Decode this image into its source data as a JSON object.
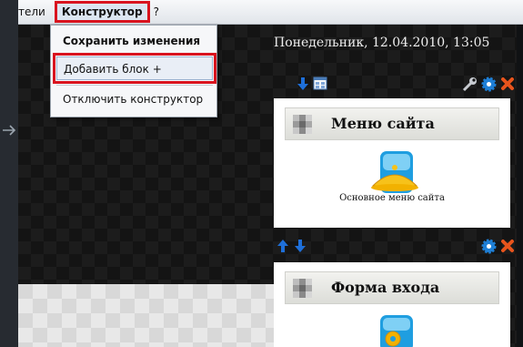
{
  "menubar": {
    "items": [
      "тели",
      "Конструктор",
      "?"
    ]
  },
  "dropdown": {
    "save": "Сохранить изменения",
    "add": "Добавить блок +",
    "disable": "Отключить конструктор"
  },
  "date_text": "Понедельник, 12.04.2010, 13:05",
  "blocks": [
    {
      "title": "Меню сайта",
      "caption": "Основное меню сайта"
    },
    {
      "title": "Форма входа"
    }
  ],
  "icons": {
    "arrow_color": "#1e6fd9",
    "gear_color": "#1e7fd6",
    "close_color": "#e8541c",
    "highlight_color": "#d9141f"
  }
}
